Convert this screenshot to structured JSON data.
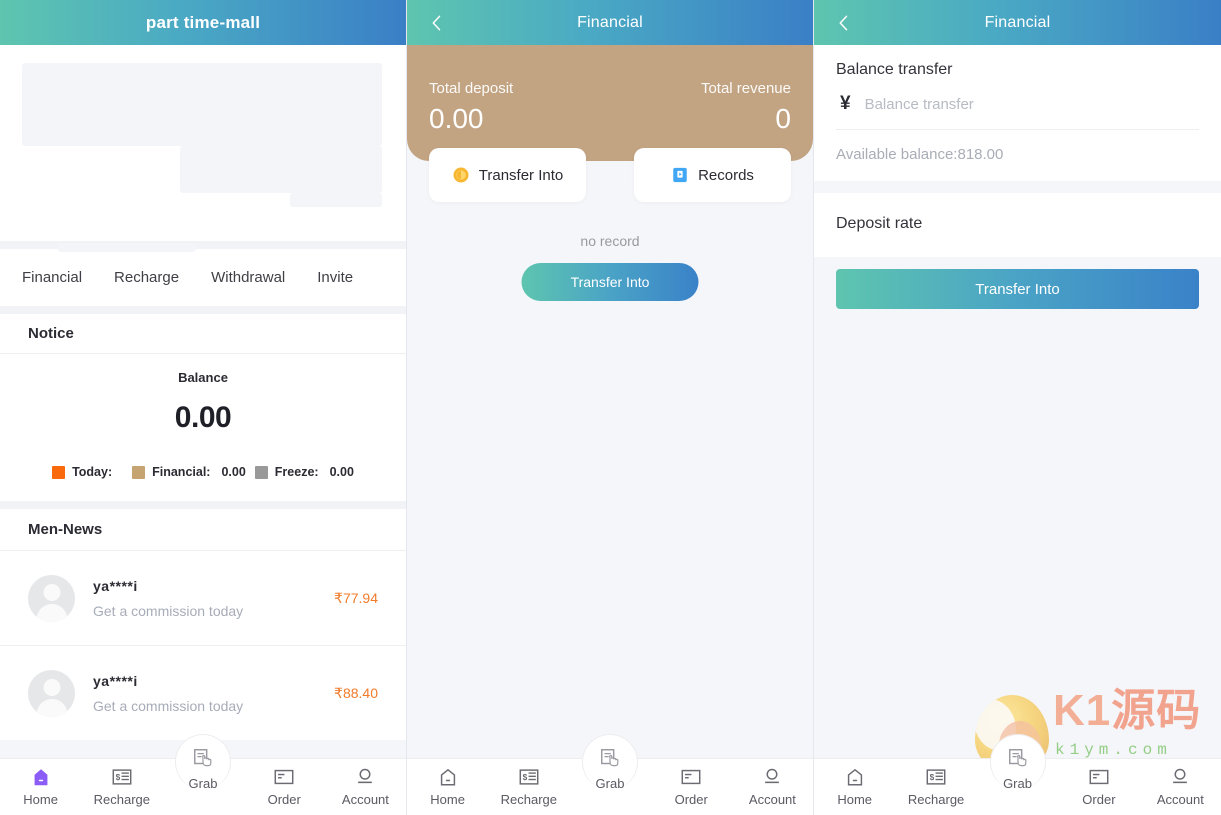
{
  "panels": {
    "left": {
      "header": {
        "title": "part time-mall",
        "icon": ""
      },
      "tabs": [
        {
          "label": "Financial"
        },
        {
          "label": "Recharge"
        },
        {
          "label": "Withdrawal"
        },
        {
          "label": "Invite"
        }
      ],
      "notice_title": "Notice",
      "balance": {
        "label": "Balance",
        "value": "0.00",
        "legend": [
          {
            "label": "Today:",
            "value": "",
            "color": "#f96a0d"
          },
          {
            "label": "Financial:",
            "value": "0.00",
            "color": "#c6a472"
          },
          {
            "label": "Freeze:",
            "value": "0.00",
            "color": "#999999"
          }
        ]
      },
      "news_title": "Men-News",
      "news": [
        {
          "name": "ya****i",
          "sub": "Get a commission today",
          "amount": "₹77.94"
        },
        {
          "name": "ya****i",
          "sub": "Get a commission today",
          "amount": "₹88.40"
        }
      ]
    },
    "middle": {
      "header": {
        "title": "Financial",
        "back": "back-icon"
      },
      "summary": {
        "deposit_label": "Total deposit",
        "deposit_value": "0.00",
        "revenue_label": "Total revenue",
        "revenue_value": "0",
        "banner_color": "#c2a483"
      },
      "actions": [
        {
          "label": "Transfer Into",
          "icon": "coin-icon"
        },
        {
          "label": "Records",
          "icon": "records-icon"
        }
      ],
      "empty_text": "no record",
      "cta": "Transfer Into"
    },
    "right": {
      "header": {
        "title": "Financial",
        "back": "back-icon"
      },
      "section_title": "Balance transfer",
      "currency_symbol": "¥",
      "input_value": "",
      "input_placeholder": "Balance transfer",
      "available": "Available balance:818.00",
      "rate_label": "Deposit rate",
      "cta": "Transfer Into"
    }
  },
  "tabbar": [
    {
      "label": "Home",
      "icon": "home-icon"
    },
    {
      "label": "Recharge",
      "icon": "recharge-icon"
    },
    {
      "label": "Grab",
      "icon": "grab-icon"
    },
    {
      "label": "Order",
      "icon": "order-icon"
    },
    {
      "label": "Account",
      "icon": "account-icon"
    }
  ],
  "tabbar_active": {
    "left": "Home",
    "accent": "#8b5cf6"
  },
  "watermark": {
    "brand": "K1",
    "brand_cn": "源码",
    "url": "k1ym.com"
  }
}
